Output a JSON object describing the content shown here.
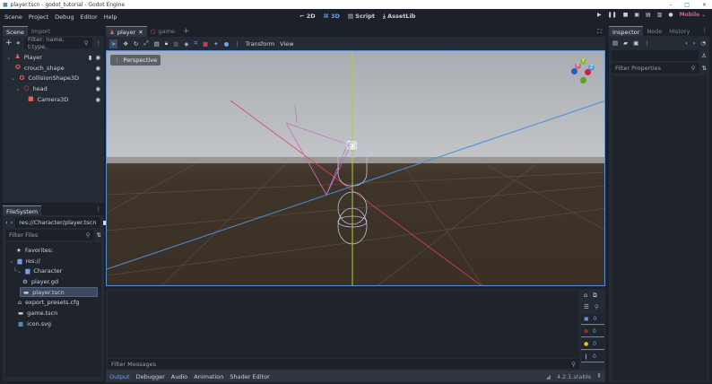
{
  "window": {
    "title": "player.tscn - godot_tutorial - Godot Engine",
    "min": "–",
    "max": "□",
    "close": "✕"
  },
  "menu": [
    "Scene",
    "Project",
    "Debug",
    "Editor",
    "Help"
  ],
  "workspaces": [
    "2D",
    "3D",
    "Script",
    "AssetLib"
  ],
  "renderer": "Mobile",
  "scene_dock": {
    "tabs": [
      "Scene",
      "Import"
    ],
    "filter_placeholder": "Filter: name, t:type,",
    "nodes": [
      {
        "name": "Player",
        "color": "#e0605a"
      },
      {
        "name": "crouch_shape",
        "color": "#e0605a"
      },
      {
        "name": "CollisionShape3D",
        "color": "#e0605a"
      },
      {
        "name": "head",
        "color": "#e0605a"
      },
      {
        "name": "Camera3D",
        "color": "#e0605a"
      }
    ]
  },
  "filesystem": {
    "tab": "FileSystem",
    "path": "res://Character/player.tscn",
    "filter_placeholder": "Filter Files",
    "items": [
      "Favorites:",
      "res://",
      "Character",
      "player.gd",
      "player.tscn",
      "export_presets.cfg",
      "game.tscn",
      "icon.svg"
    ]
  },
  "editor_tabs": [
    "player",
    "game"
  ],
  "toolbar": {
    "transform": "Transform",
    "view": "View"
  },
  "viewport": {
    "perspective": "Perspective",
    "gizmo": {
      "x": "X",
      "y": "Y",
      "z": "Z"
    }
  },
  "bottom": {
    "filter_placeholder": "Filter Messages",
    "tabs": [
      "Output",
      "Debugger",
      "Audio",
      "Animation",
      "Shader Editor"
    ],
    "version": "4.2.1.stable",
    "counts": [
      "0",
      "0",
      "0",
      "0"
    ]
  },
  "inspector": {
    "tabs": [
      "Inspector",
      "Node",
      "History"
    ],
    "filter_placeholder": "Filter Properties"
  }
}
